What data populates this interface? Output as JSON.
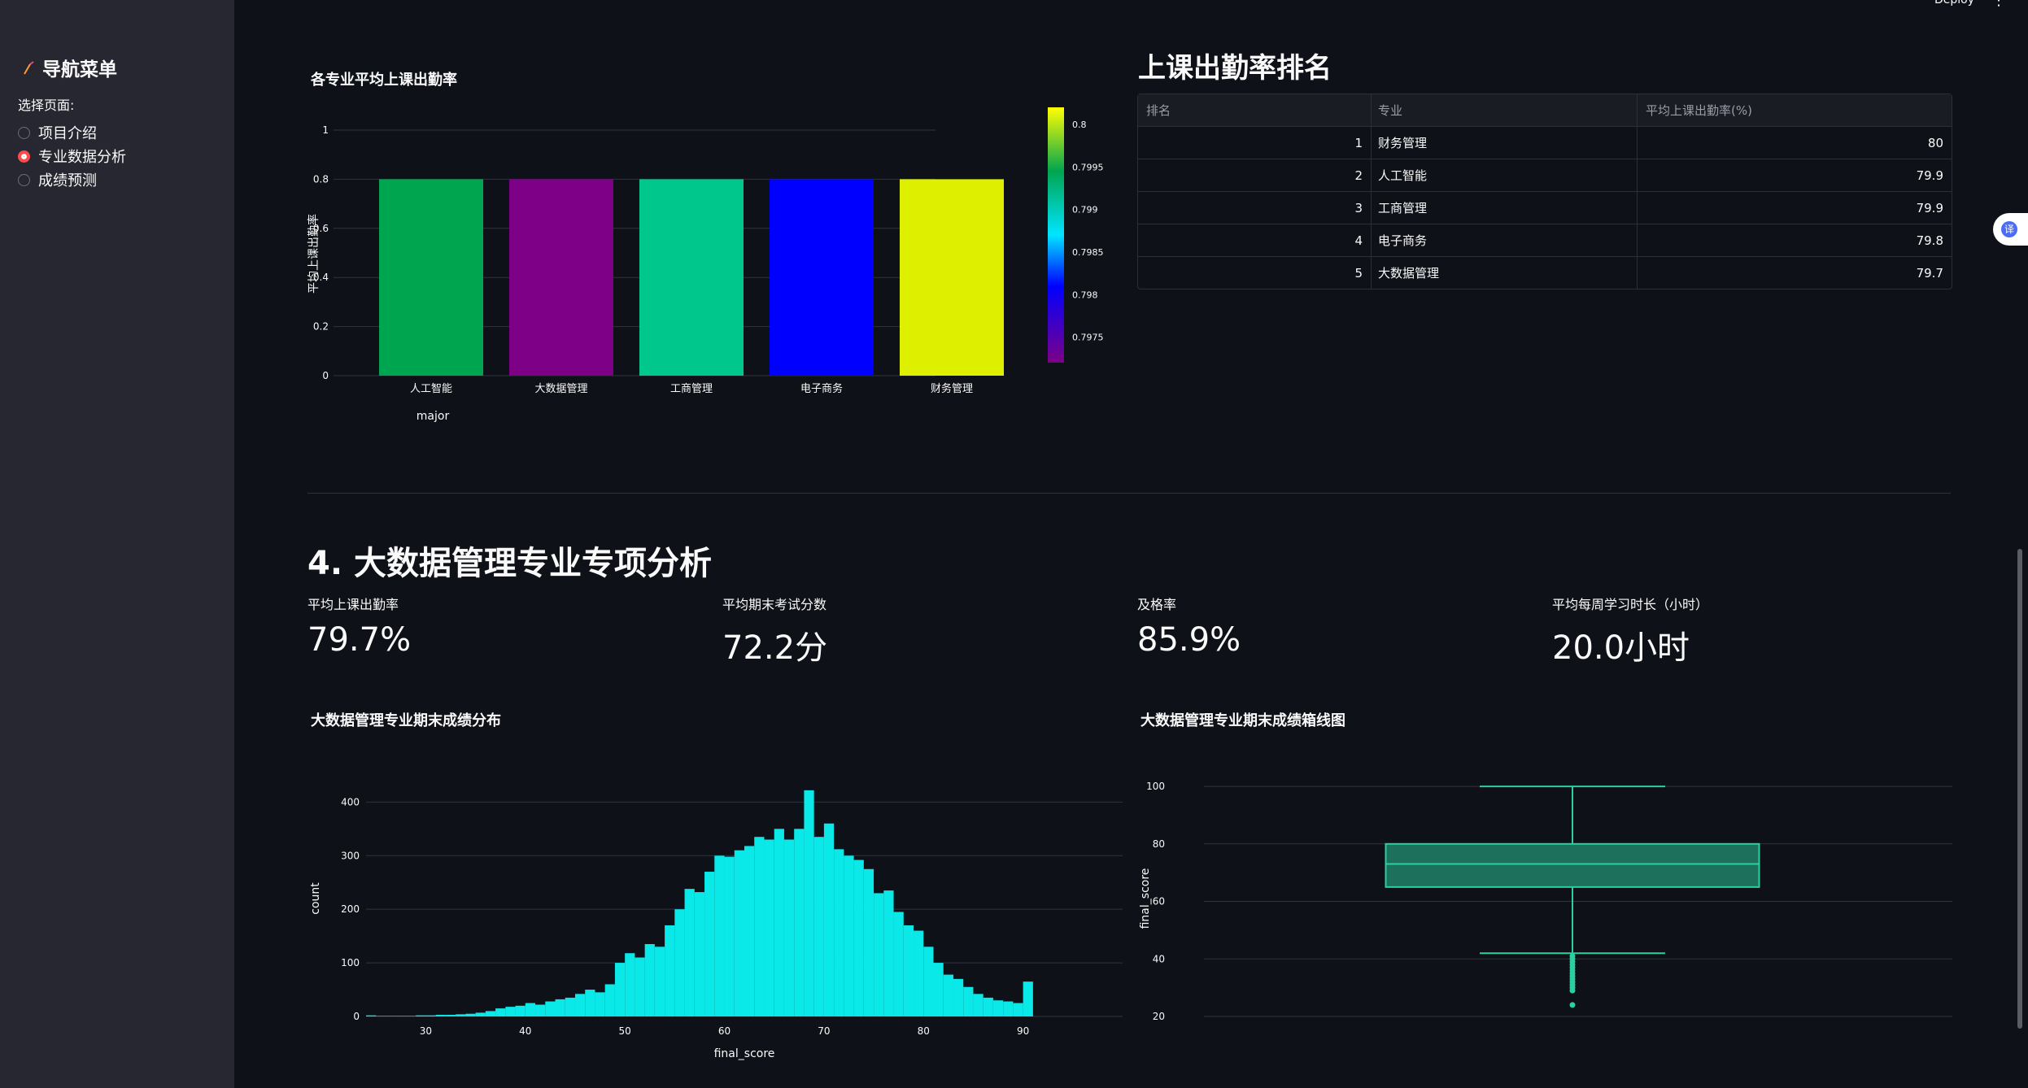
{
  "sidebar": {
    "title": "导航菜单",
    "select_label": "选择页面:",
    "options": [
      "项目介绍",
      "专业数据分析",
      "成绩预测"
    ],
    "selected": "专业数据分析"
  },
  "header": {
    "deploy": "Deploy",
    "menu_icon": "⋮"
  },
  "bar_chart": {
    "title": "各专业平均上课出勤率",
    "ylabel": "平均上课出勤率",
    "xlabel": "major",
    "y_ticks": [
      "0",
      "0.2",
      "0.4",
      "0.6",
      "0.8",
      "1"
    ],
    "colorbar_ticks": [
      "0.8",
      "0.7995",
      "0.799",
      "0.7985",
      "0.798",
      "0.7975"
    ]
  },
  "ranking": {
    "title": "上课出勤率排名",
    "columns": [
      "排名",
      "专业",
      "平均上课出勤率(%)"
    ],
    "rows": [
      [
        "1",
        "财务管理",
        "80"
      ],
      [
        "2",
        "人工智能",
        "79.9"
      ],
      [
        "3",
        "工商管理",
        "79.9"
      ],
      [
        "4",
        "电子商务",
        "79.8"
      ],
      [
        "5",
        "大数据管理",
        "79.7"
      ]
    ]
  },
  "section4": {
    "title": "4. 大数据管理专业专项分析",
    "metrics": [
      {
        "label": "平均上课出勤率",
        "value": "79.7%"
      },
      {
        "label": "平均期末考试分数",
        "value": "72.2分"
      },
      {
        "label": "及格率",
        "value": "85.9%"
      },
      {
        "label": "平均每周学习时长（小时）",
        "value": "20.0小时"
      }
    ],
    "hist_title": "大数据管理专业期末成绩分布",
    "box_title": "大数据管理专业期末成绩箱线图"
  },
  "chart_data": [
    {
      "type": "bar",
      "title": "各专业平均上课出勤率",
      "xlabel": "major",
      "ylabel": "平均上课出勤率",
      "categories": [
        "人工智能",
        "大数据管理",
        "工商管理",
        "电子商务",
        "财务管理"
      ],
      "values": [
        0.7993,
        0.7972,
        0.7988,
        0.7982,
        0.8002
      ],
      "colors": [
        "#00a550",
        "#7d0087",
        "#00c78c",
        "#0000ff",
        "#dfef00"
      ],
      "ylim": [
        0,
        1
      ],
      "colorbar": {
        "min": 0.7972,
        "max": 0.8002,
        "ticks": [
          0.7975,
          0.798,
          0.7985,
          0.799,
          0.7995,
          0.8
        ]
      }
    },
    {
      "type": "bar",
      "subtype": "histogram",
      "title": "大数据管理专业期末成绩分布",
      "xlabel": "final_score",
      "ylabel": "count",
      "x_start": 24,
      "bin_width": 1,
      "values": [
        2,
        1,
        1,
        1,
        1,
        2,
        2,
        3,
        3,
        4,
        5,
        7,
        10,
        15,
        18,
        20,
        25,
        22,
        28,
        32,
        35,
        42,
        50,
        45,
        60,
        100,
        118,
        110,
        135,
        130,
        170,
        200,
        238,
        232,
        270,
        300,
        298,
        310,
        318,
        335,
        330,
        350,
        330,
        350,
        422,
        335,
        360,
        312,
        300,
        292,
        275,
        230,
        235,
        195,
        170,
        160,
        130,
        100,
        78,
        70,
        55,
        42,
        35,
        30,
        28,
        25,
        65
      ],
      "color": "#0be8e8",
      "xlim": [
        24,
        100
      ],
      "ylim": [
        0,
        440
      ],
      "x_ticks": [
        30,
        40,
        50,
        60,
        70,
        80,
        90
      ],
      "y_ticks": [
        0,
        100,
        200,
        300,
        400
      ]
    },
    {
      "type": "box",
      "title": "大数据管理专业期末成绩箱线图",
      "ylabel": "final_score",
      "min": 42,
      "q1": 65,
      "median": 73,
      "q3": 80,
      "max": 100,
      "outliers": [
        41,
        40,
        39,
        38,
        37,
        36,
        35,
        34,
        33,
        32,
        31,
        30,
        29,
        24
      ],
      "color": "#2ccfa0",
      "ylim": [
        20,
        102
      ],
      "y_ticks": [
        20,
        40,
        60,
        80,
        100
      ]
    }
  ]
}
